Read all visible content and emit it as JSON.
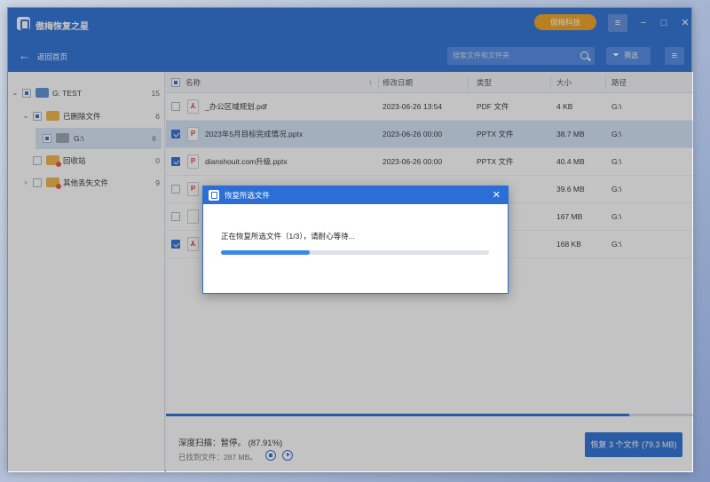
{
  "app": {
    "title": "傲梅恢复之星",
    "brand": "傲梅科技"
  },
  "window": {
    "menu_icon": "menu-icon",
    "min_icon": "minimize-icon",
    "max_icon": "maximize-icon",
    "close_icon": "close-icon"
  },
  "nav": {
    "back_label": "返回首页",
    "search_placeholder": "搜索文件和文件夹",
    "filter_label": "筛选"
  },
  "sidebar": {
    "items": [
      {
        "label": "G: TEST",
        "count": "15",
        "checkbox": "partial",
        "expanded": true
      },
      {
        "label": "已删除文件",
        "count": "6",
        "checkbox": "partial",
        "expanded": true
      },
      {
        "label": "G:\\",
        "count": "6",
        "checkbox": "partial",
        "selected": true
      },
      {
        "label": "回收站",
        "count": "0",
        "checkbox": "unchecked"
      },
      {
        "label": "其他丢失文件",
        "count": "9",
        "checkbox": "unchecked",
        "expanded": false
      }
    ]
  },
  "table": {
    "columns": {
      "name": "名称",
      "modified": "修改日期",
      "type": "类型",
      "size": "大小",
      "path": "路径"
    },
    "rows": [
      {
        "name": "_办公区域规划.pdf",
        "date": "2023-06-26 13:54",
        "type": "PDF 文件",
        "size": "4 KB",
        "path": "G:\\",
        "checked": false,
        "icon": "pdf"
      },
      {
        "name": "2023年5月目标完成情况.pptx",
        "date": "2023-06-26 00:00",
        "type": "PPTX 文件",
        "size": "38.7 MB",
        "path": "G:\\",
        "checked": true,
        "selected": true,
        "icon": "ppt"
      },
      {
        "name": "dianshouit.com升级.pptx",
        "date": "2023-06-26 00:00",
        "type": "PPTX 文件",
        "size": "40.4 MB",
        "path": "G:\\",
        "checked": true,
        "icon": "ppt"
      },
      {
        "name": "",
        "date": "",
        "type": "",
        "size": "39.6 MB",
        "path": "G:\\",
        "checked": false,
        "icon": "ppt"
      },
      {
        "name": "",
        "date": "",
        "type": "",
        "size": "167 MB",
        "path": "G:\\",
        "checked": false,
        "icon": "blank"
      },
      {
        "name": "",
        "date": "",
        "type": "",
        "size": "168 KB",
        "path": "G:\\",
        "checked": true,
        "icon": "pdf"
      }
    ]
  },
  "status": {
    "scan_text": "深度扫描：暂停。 (87.91%)",
    "scan_progress": 0.8791,
    "found_text": "已找到文件：287 MB。",
    "recover_button": "恢复 3 个文件 (79.3 MB)"
  },
  "dialog": {
    "title": "恢复所选文件",
    "message": "正在恢复所选文件（1/3），请耐心等待...",
    "progress": 0.33,
    "close_glyph": "✕"
  }
}
